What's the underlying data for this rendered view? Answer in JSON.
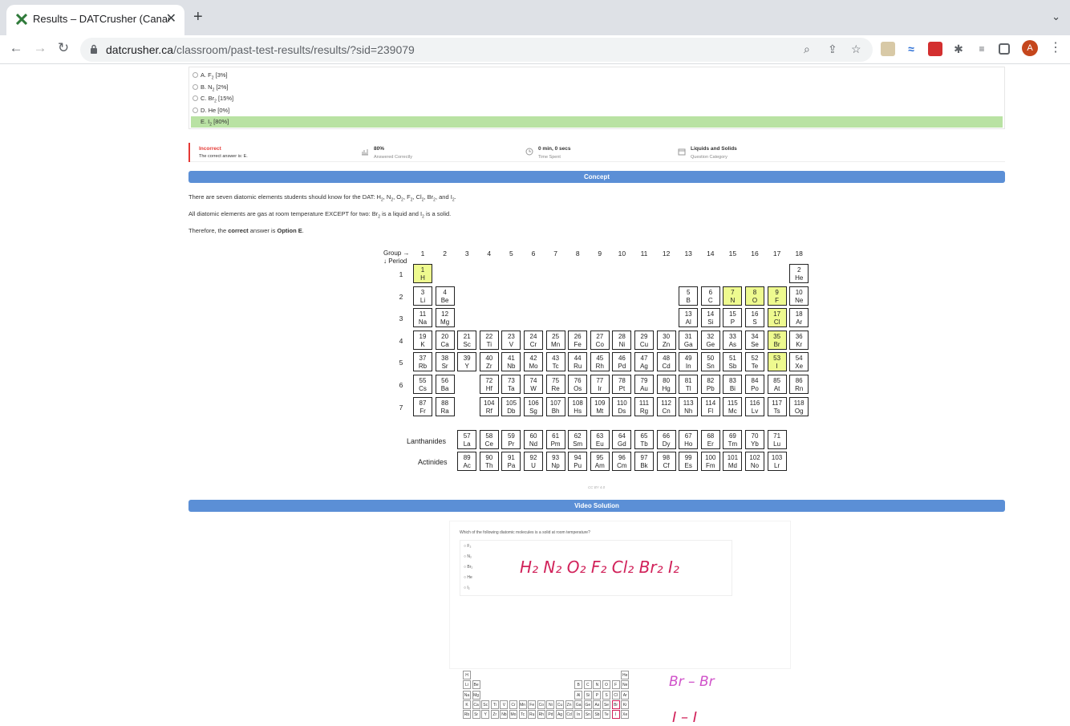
{
  "browser": {
    "tab_title": "Results – DATCrusher (Canadian",
    "url_domain": "datcrusher.ca",
    "url_path": "/classroom/past-test-results/results/?sid=239079",
    "avatar_letter": "A"
  },
  "question": {
    "options": [
      {
        "label": "A. F",
        "sub": "2",
        "suffix": " [3%]"
      },
      {
        "label": "B. N",
        "sub": "2",
        "suffix": " [2%]"
      },
      {
        "label": "C. Br",
        "sub": "2",
        "suffix": " [15%]"
      },
      {
        "label": "D. He",
        "sub": "",
        "suffix": " [0%]"
      },
      {
        "label": "E. I",
        "sub": "2",
        "suffix": " [80%]"
      }
    ]
  },
  "stats": {
    "result": "Incorrect",
    "correct_answer": "The correct answer is: E.",
    "percent": "80%",
    "percent_label": "Answered Correctly",
    "time": "0 min, 0 secs",
    "time_label": "Time Spent",
    "category": "Liquids and Solids",
    "category_label": "Question Category"
  },
  "concept": {
    "banner": "Concept",
    "p1_pre": "There are seven diatomic elements students should know for the DAT: H",
    "p1_rest": [
      {
        "t": ", N",
        "s": "2"
      },
      {
        "t": ", O",
        "s": "2"
      },
      {
        "t": ", F",
        "s": "2"
      },
      {
        "t": ", Cl",
        "s": "2"
      },
      {
        "t": ", Br",
        "s": "2"
      },
      {
        "t": ", and I",
        "s": "2"
      }
    ],
    "p2_a": "All diatomic elements are gas at room temperature EXCEPT for two: Br",
    "p2_b": " is a liquid and I",
    "p2_c": " is a solid.",
    "p3_a": "Therefore, the ",
    "p3_b": "correct",
    "p3_c": " answer is ",
    "p3_d": "Option E",
    "p3_e": ".",
    "sub2": "2"
  },
  "ptable": {
    "group_label": "Group →",
    "period_label": "↓ Period",
    "groups": [
      "1",
      "2",
      "3",
      "4",
      "5",
      "6",
      "7",
      "8",
      "9",
      "10",
      "11",
      "12",
      "13",
      "14",
      "15",
      "16",
      "17",
      "18"
    ],
    "periods": [
      "1",
      "2",
      "3",
      "4",
      "5",
      "6",
      "7"
    ],
    "lanthanides_label": "Lanthanides",
    "actinides_label": "Actinides",
    "license": "CC BY 4.0",
    "highlight": [
      "H",
      "N",
      "O",
      "F",
      "Cl",
      "Br",
      "I"
    ],
    "rows": [
      [
        [
          "1",
          "H"
        ],
        null,
        null,
        null,
        null,
        null,
        null,
        null,
        null,
        null,
        null,
        null,
        null,
        null,
        null,
        null,
        null,
        [
          "2",
          "He"
        ]
      ],
      [
        [
          "3",
          "Li"
        ],
        [
          "4",
          "Be"
        ],
        null,
        null,
        null,
        null,
        null,
        null,
        null,
        null,
        null,
        null,
        [
          "5",
          "B"
        ],
        [
          "6",
          "C"
        ],
        [
          "7",
          "N"
        ],
        [
          "8",
          "O"
        ],
        [
          "9",
          "F"
        ],
        [
          "10",
          "Ne"
        ]
      ],
      [
        [
          "11",
          "Na"
        ],
        [
          "12",
          "Mg"
        ],
        null,
        null,
        null,
        null,
        null,
        null,
        null,
        null,
        null,
        null,
        [
          "13",
          "Al"
        ],
        [
          "14",
          "Si"
        ],
        [
          "15",
          "P"
        ],
        [
          "16",
          "S"
        ],
        [
          "17",
          "Cl"
        ],
        [
          "18",
          "Ar"
        ]
      ],
      [
        [
          "19",
          "K"
        ],
        [
          "20",
          "Ca"
        ],
        [
          "21",
          "Sc"
        ],
        [
          "22",
          "Ti"
        ],
        [
          "23",
          "V"
        ],
        [
          "24",
          "Cr"
        ],
        [
          "25",
          "Mn"
        ],
        [
          "26",
          "Fe"
        ],
        [
          "27",
          "Co"
        ],
        [
          "28",
          "Ni"
        ],
        [
          "29",
          "Cu"
        ],
        [
          "30",
          "Zn"
        ],
        [
          "31",
          "Ga"
        ],
        [
          "32",
          "Ge"
        ],
        [
          "33",
          "As"
        ],
        [
          "34",
          "Se"
        ],
        [
          "35",
          "Br"
        ],
        [
          "36",
          "Kr"
        ]
      ],
      [
        [
          "37",
          "Rb"
        ],
        [
          "38",
          "Sr"
        ],
        [
          "39",
          "Y"
        ],
        [
          "40",
          "Zr"
        ],
        [
          "41",
          "Nb"
        ],
        [
          "42",
          "Mo"
        ],
        [
          "43",
          "Tc"
        ],
        [
          "44",
          "Ru"
        ],
        [
          "45",
          "Rh"
        ],
        [
          "46",
          "Pd"
        ],
        [
          "47",
          "Ag"
        ],
        [
          "48",
          "Cd"
        ],
        [
          "49",
          "In"
        ],
        [
          "50",
          "Sn"
        ],
        [
          "51",
          "Sb"
        ],
        [
          "52",
          "Te"
        ],
        [
          "53",
          "I"
        ],
        [
          "54",
          "Xe"
        ]
      ],
      [
        [
          "55",
          "Cs"
        ],
        [
          "56",
          "Ba"
        ],
        null,
        [
          "72",
          "Hf"
        ],
        [
          "73",
          "Ta"
        ],
        [
          "74",
          "W"
        ],
        [
          "75",
          "Re"
        ],
        [
          "76",
          "Os"
        ],
        [
          "77",
          "Ir"
        ],
        [
          "78",
          "Pt"
        ],
        [
          "79",
          "Au"
        ],
        [
          "80",
          "Hg"
        ],
        [
          "81",
          "Tl"
        ],
        [
          "82",
          "Pb"
        ],
        [
          "83",
          "Bi"
        ],
        [
          "84",
          "Po"
        ],
        [
          "85",
          "At"
        ],
        [
          "86",
          "Rn"
        ]
      ],
      [
        [
          "87",
          "Fr"
        ],
        [
          "88",
          "Ra"
        ],
        null,
        [
          "104",
          "Rf"
        ],
        [
          "105",
          "Db"
        ],
        [
          "106",
          "Sg"
        ],
        [
          "107",
          "Bh"
        ],
        [
          "108",
          "Hs"
        ],
        [
          "109",
          "Mt"
        ],
        [
          "110",
          "Ds"
        ],
        [
          "111",
          "Rg"
        ],
        [
          "112",
          "Cn"
        ],
        [
          "113",
          "Nh"
        ],
        [
          "114",
          "Fl"
        ],
        [
          "115",
          "Mc"
        ],
        [
          "116",
          "Lv"
        ],
        [
          "117",
          "Ts"
        ],
        [
          "118",
          "Og"
        ]
      ]
    ],
    "lanthanides": [
      [
        "57",
        "La"
      ],
      [
        "58",
        "Ce"
      ],
      [
        "59",
        "Pr"
      ],
      [
        "60",
        "Nd"
      ],
      [
        "61",
        "Pm"
      ],
      [
        "62",
        "Sm"
      ],
      [
        "63",
        "Eu"
      ],
      [
        "64",
        "Gd"
      ],
      [
        "65",
        "Tb"
      ],
      [
        "66",
        "Dy"
      ],
      [
        "67",
        "Ho"
      ],
      [
        "68",
        "Er"
      ],
      [
        "69",
        "Tm"
      ],
      [
        "70",
        "Yb"
      ],
      [
        "71",
        "Lu"
      ]
    ],
    "actinides": [
      [
        "89",
        "Ac"
      ],
      [
        "90",
        "Th"
      ],
      [
        "91",
        "Pa"
      ],
      [
        "92",
        "U"
      ],
      [
        "93",
        "Np"
      ],
      [
        "94",
        "Pu"
      ],
      [
        "95",
        "Am"
      ],
      [
        "96",
        "Cm"
      ],
      [
        "97",
        "Bk"
      ],
      [
        "98",
        "Cf"
      ],
      [
        "99",
        "Es"
      ],
      [
        "100",
        "Fm"
      ],
      [
        "101",
        "Md"
      ],
      [
        "102",
        "No"
      ],
      [
        "103",
        "Lr"
      ]
    ]
  },
  "video": {
    "banner": "Video Solution",
    "question": "Which of the following diatomic molecules is a solid at room temperature?",
    "handwriting_line1": "H₂ N₂ O₂ F₂ Cl₂ Br₂ I₂",
    "handwriting_br": "Br – Br",
    "handwriting_i": "I – I",
    "mini_opts": [
      "F₂",
      "N₂",
      "Br₂",
      "He",
      "I₂"
    ],
    "mini_rows": [
      [
        "H",
        "",
        "",
        "",
        "",
        "",
        "",
        "",
        "",
        "",
        "",
        "",
        "",
        "",
        "",
        "",
        "",
        "He"
      ],
      [
        "Li",
        "Be",
        "",
        "",
        "",
        "",
        "",
        "",
        "",
        "",
        "",
        "",
        "B",
        "C",
        "N",
        "O",
        "F",
        "Ne"
      ],
      [
        "Na",
        "Mg",
        "",
        "",
        "",
        "",
        "",
        "",
        "",
        "",
        "",
        "",
        "Al",
        "Si",
        "P",
        "S",
        "Cl",
        "Ar"
      ],
      [
        "K",
        "Ca",
        "Sc",
        "Ti",
        "V",
        "Cr",
        "Mn",
        "Fe",
        "Co",
        "Ni",
        "Cu",
        "Zn",
        "Ga",
        "Ge",
        "As",
        "Se",
        "Br",
        "Kr"
      ],
      [
        "Rb",
        "Sr",
        "Y",
        "Zr",
        "Nb",
        "Mo",
        "Tc",
        "Ru",
        "Rh",
        "Pd",
        "Ag",
        "Cd",
        "In",
        "Sn",
        "Sb",
        "Te",
        "I",
        "Xe"
      ]
    ]
  },
  "colors": {
    "accent": "#5b8fd6",
    "selected": "#b9e2a3",
    "highlight": "#eefa8f",
    "incorrect": "#e53935"
  }
}
